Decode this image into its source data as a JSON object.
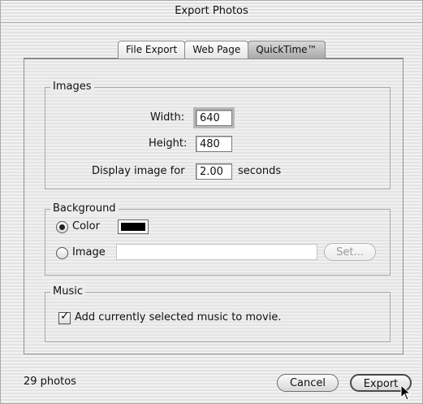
{
  "window": {
    "title": "Export Photos"
  },
  "tabs": [
    {
      "label": "File Export"
    },
    {
      "label": "Web Page"
    },
    {
      "label": "QuickTime™"
    }
  ],
  "images_group": {
    "legend": "Images",
    "width_label": "Width:",
    "width_value": "640",
    "height_label": "Height:",
    "height_value": "480",
    "display_label": "Display image for",
    "display_value": "2.00",
    "display_unit": "seconds"
  },
  "background_group": {
    "legend": "Background",
    "color_label": "Color",
    "color_selected": true,
    "swatch_color": "#000000",
    "image_label": "Image",
    "image_value": "",
    "set_button": "Set..."
  },
  "music_group": {
    "legend": "Music",
    "checkbox_label": "Add currently selected music to movie.",
    "checked": true
  },
  "footer": {
    "count": "29 photos",
    "cancel": "Cancel",
    "export": "Export"
  }
}
